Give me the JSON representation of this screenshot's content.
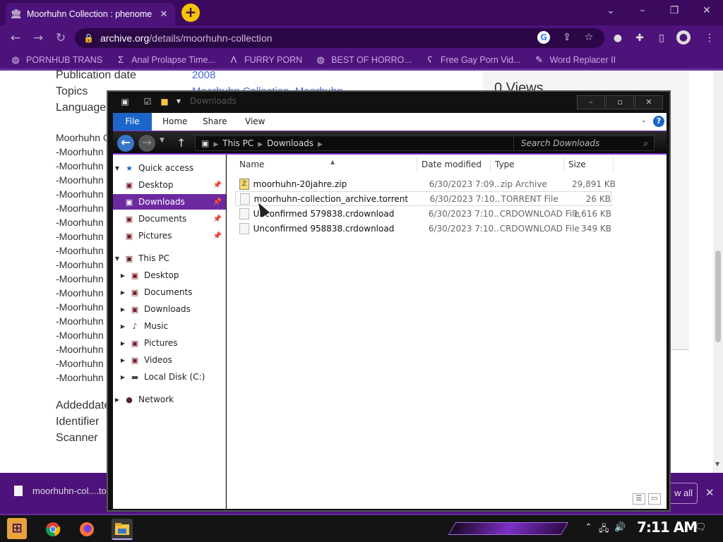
{
  "browser": {
    "tab_title": "Moorhuhn Collection : phenome",
    "tab_favicon": "archive-icon",
    "url_host": "archive.org",
    "url_path": "/details/moorhuhn-collection",
    "bookmarks": [
      {
        "label": "PORNHUB TRANS",
        "icon": "globe-icon"
      },
      {
        "label": "Anal Prolapse Time...",
        "icon": "yahoo-icon"
      },
      {
        "label": "FURRY PORN",
        "icon": "lambda-icon"
      },
      {
        "label": "BEST OF HORRO...",
        "icon": "globe-icon"
      },
      {
        "label": "Free Gay Porn Vid...",
        "icon": "bear-icon"
      },
      {
        "label": "Word Replacer II",
        "icon": "wr-icon"
      }
    ]
  },
  "webpage": {
    "meta_labels": [
      "Publication date",
      "Topics",
      "Language"
    ],
    "publication_date": "2008",
    "topics": "Moorhuhn Collection, Moorhuhn",
    "desc_head": "Moorhuhn C",
    "desc_lines": [
      "-Moorhuhn",
      "-Moorhuhn",
      "-Moorhuhn",
      "-Moorhuhn",
      "-Moorhuhn",
      "-Moorhuhn",
      "-Moorhuhn",
      "-Moorhuhn",
      "-Moorhuhn",
      "-Moorhuhn",
      "-Moorhuhn",
      "-Moorhuhn",
      "-Moorhuhn",
      "-Moorhuhn",
      "-Moorhuhn",
      "-Moorhuhn",
      "-Moorhuhn"
    ],
    "meta_bottom": [
      "Addeddate",
      "Identifier",
      "Scanner"
    ],
    "views": "0 Views"
  },
  "download_bar": {
    "filename": "moorhuhn-col....to",
    "show_all": "w all"
  },
  "explorer": {
    "title": "Downloads",
    "ribbon_tabs": [
      "File",
      "Home",
      "Share",
      "View"
    ],
    "path": [
      "This PC",
      "Downloads"
    ],
    "search_placeholder": "Search Downloads",
    "nav": {
      "quick_access": "Quick access",
      "quick_items": [
        "Desktop",
        "Downloads",
        "Documents",
        "Pictures"
      ],
      "this_pc": "This PC",
      "pc_items": [
        "Desktop",
        "Documents",
        "Downloads",
        "Music",
        "Pictures",
        "Videos",
        "Local Disk (C:)"
      ],
      "network": "Network"
    },
    "columns": [
      "Name",
      "Date modified",
      "Type",
      "Size"
    ],
    "files": [
      {
        "name": "moorhuhn-20jahre.zip",
        "date": "6/30/2023 7:09...",
        "type": "zip Archive",
        "size": "29,891 KB"
      },
      {
        "name": "moorhuhn-collection_archive.torrent",
        "date": "6/30/2023 7:10...",
        "type": "TORRENT File",
        "size": "26 KB"
      },
      {
        "name": "Unconfirmed 579838.crdownload",
        "date": "6/30/2023 7:10...",
        "type": "CRDOWNLOAD File",
        "size": "1,616 KB"
      },
      {
        "name": "Unconfirmed 958838.crdownload",
        "date": "6/30/2023 7:10...",
        "type": "CRDOWNLOAD File",
        "size": "349 KB"
      }
    ]
  },
  "taskbar": {
    "clock": "7:11 AM"
  }
}
